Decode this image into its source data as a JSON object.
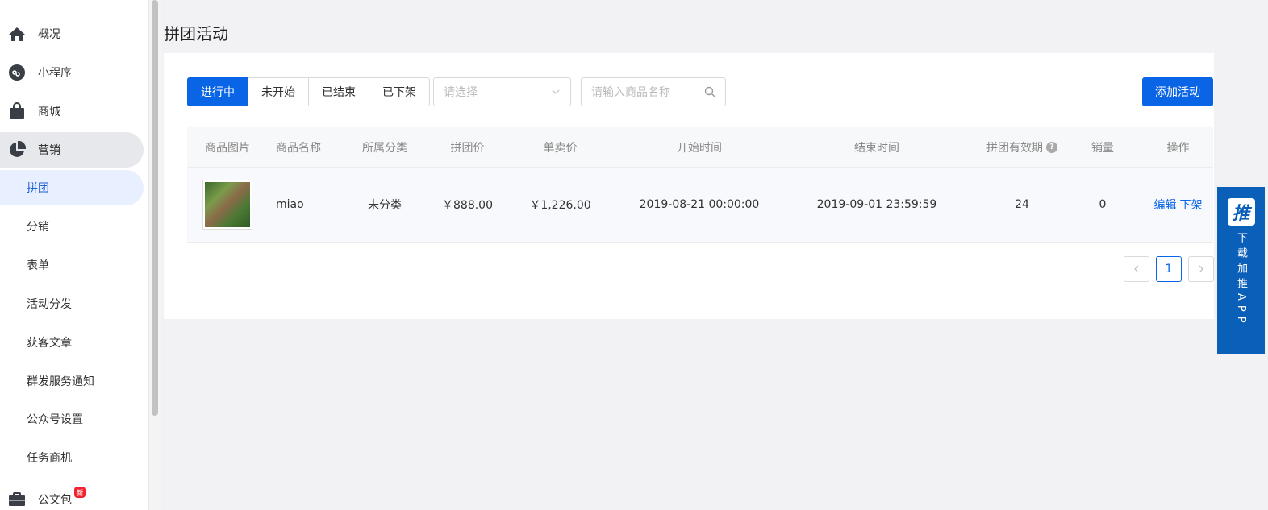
{
  "sidebar": {
    "items": [
      {
        "label": "概况",
        "icon": "home-icon"
      },
      {
        "label": "小程序",
        "icon": "mini-program-icon"
      },
      {
        "label": "商城",
        "icon": "shopping-bag-icon"
      },
      {
        "label": "营销",
        "icon": "pie-chart-icon"
      },
      {
        "label": "拼团"
      },
      {
        "label": "分销"
      },
      {
        "label": "表单"
      },
      {
        "label": "活动分发"
      },
      {
        "label": "获客文章"
      },
      {
        "label": "群发服务通知"
      },
      {
        "label": "公众号设置"
      },
      {
        "label": "任务商机"
      },
      {
        "label": "公文包",
        "icon": "briefcase-icon",
        "badge": "新"
      }
    ]
  },
  "page": {
    "title": "拼团活动"
  },
  "filters": {
    "tabs": [
      "进行中",
      "未开始",
      "已结束",
      "已下架"
    ],
    "active_tab": "进行中",
    "select_placeholder": "请选择",
    "search_placeholder": "请输入商品名称",
    "add_button": "添加活动"
  },
  "table": {
    "headers": [
      "商品图片",
      "商品名称",
      "所属分类",
      "拼团价",
      "单卖价",
      "开始时间",
      "结束时间",
      "拼团有效期",
      "销量",
      "操作"
    ],
    "rows": [
      {
        "name": "miao",
        "category": "未分类",
        "group_price": "￥888.00",
        "single_price": "￥1,226.00",
        "start_time": "2019-08-21 00:00:00",
        "end_time": "2019-09-01 23:59:59",
        "validity": "24",
        "sales": "0",
        "actions": [
          "编辑",
          "下架"
        ]
      }
    ]
  },
  "pagination": {
    "prev": "<",
    "current": "1",
    "next": ">"
  },
  "float_app": {
    "logo": "推",
    "text": "下载加推APP"
  },
  "colors": {
    "primary": "#0a64e6",
    "float_bg": "#0a5fb8"
  }
}
